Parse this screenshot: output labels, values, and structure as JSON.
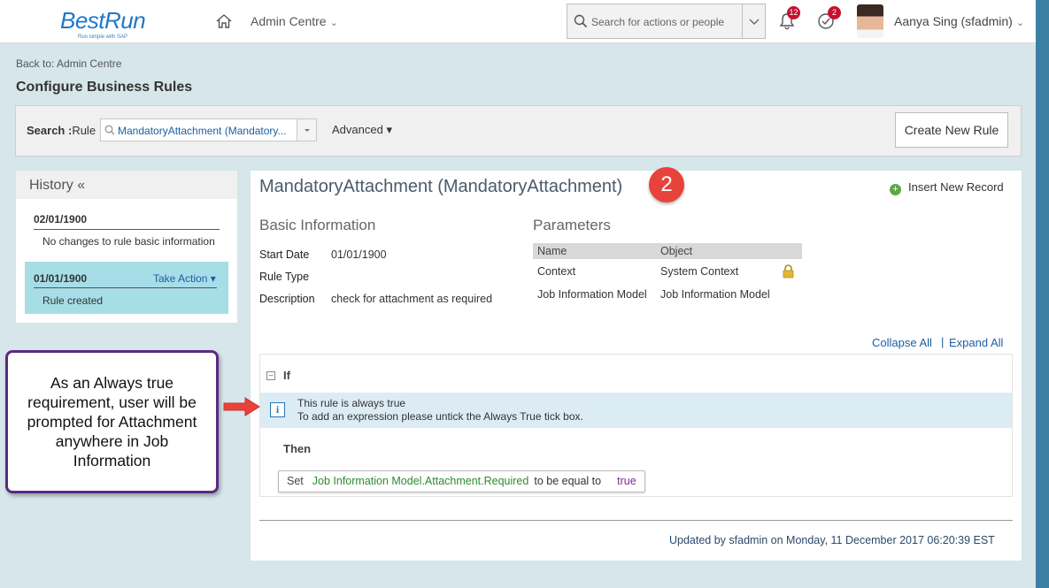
{
  "topbar": {
    "logo_text": "BestRun",
    "logo_tagline": "Run simple with SAP",
    "menu_label": "Admin Centre",
    "search_placeholder": "Search for actions or people",
    "notifications_count": "12",
    "todo_count": "2",
    "user_name": "Aanya Sing (sfadmin)"
  },
  "header": {
    "back_link": "Back to: Admin Centre",
    "title": "Configure Business Rules"
  },
  "search": {
    "label_bold": "Search :",
    "label_rule": "Rule",
    "selected_rule": "MandatoryAttachment (Mandatory...",
    "advanced_label": "Advanced",
    "create_button": "Create New Rule"
  },
  "history": {
    "title": "History «",
    "entries": [
      {
        "date": "02/01/1900",
        "description": "No changes to rule basic information"
      },
      {
        "date": "01/01/1900",
        "action": "Take Action",
        "description": "Rule created"
      }
    ]
  },
  "rule": {
    "title": "MandatoryAttachment (MandatoryAttachment)",
    "step_badge": "2",
    "insert_record": "Insert New Record",
    "basic_info_heading": "Basic Information",
    "parameters_heading": "Parameters",
    "basic_info": {
      "start_date_label": "Start Date",
      "start_date": "01/01/1900",
      "rule_type_label": "Rule Type",
      "rule_type": "",
      "description_label": "Description",
      "description": "check for attachment as required"
    },
    "parameters": {
      "headers": [
        "Name",
        "Object"
      ],
      "rows": [
        {
          "name": "Context",
          "object": "System Context",
          "locked": true
        },
        {
          "name": "Job Information Model",
          "object": "Job Information Model",
          "locked": false
        }
      ]
    },
    "collapse_all": "Collapse All",
    "separator": "|",
    "expand_all": "Expand All",
    "if_label": "If",
    "info_line1": "This rule is always true",
    "info_line2": "To add an expression please untick the Always True tick box.",
    "then_label": "Then",
    "set_statement": {
      "keyword": "Set",
      "field": "Job Information Model.Attachment.Required",
      "operator": "to be equal to",
      "value": "true"
    },
    "updated_text": "Updated by sfadmin on Monday, 11 December 2017 06:20:39 EST"
  },
  "callout": {
    "text": "As an Always true requirement, user will be prompted for Attachment anywhere in Job Information"
  },
  "colors": {
    "accent_blue": "#1b5fa3",
    "history_highlight": "#a7dde7",
    "info_band": "#dcecf4",
    "callout_border": "#5b2a84",
    "arrow_red": "#e8433b",
    "badge_red": "#c8102e"
  },
  "icons": [
    "home-icon",
    "search-icon",
    "chevron-down-icon",
    "bell-icon",
    "todo-check-icon",
    "lock-icon",
    "plus-circle-icon",
    "info-icon",
    "collapse-toggle-icon",
    "arrow-right-icon"
  ]
}
